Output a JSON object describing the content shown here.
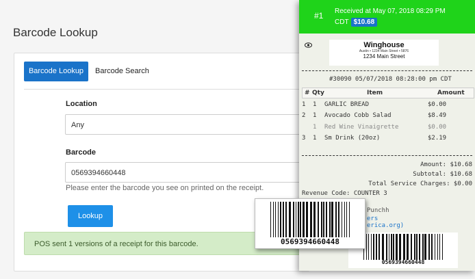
{
  "page": {
    "title": "Barcode Lookup"
  },
  "tabs": {
    "lookup": "Barcode Lookup",
    "search": "Barcode Search"
  },
  "form": {
    "location_label": "Location",
    "location_value": "Any",
    "barcode_label": "Barcode",
    "barcode_value": "0569394660448",
    "help": "Please enter the barcode you see on printed on the receipt.",
    "button": "Lookup",
    "alert": "POS sent 1 versions of a receipt for this barcode."
  },
  "receipt": {
    "number": "#1",
    "received": "Received at May 07, 2018 08:29 PM",
    "timezone": "CDT",
    "amount_badge": "$10.68",
    "store_name": "Winghouse",
    "store_sub": "Austin • 1234 Main Street • 5876",
    "store_addr": "1234 Main Street",
    "order_line": "#30090 05/07/2018 08:28:00 pm CDT",
    "columns": [
      "#",
      "Qty",
      "Item",
      "Amount"
    ],
    "items": [
      {
        "n": "1",
        "qty": "1",
        "name": "GARLIC BREAD",
        "amount": "$0.00",
        "muted": false
      },
      {
        "n": "2",
        "qty": "1",
        "name": "Avocado Cobb Salad",
        "amount": "$8.49",
        "muted": false
      },
      {
        "n": "",
        "qty": "1",
        "name": "Red Wine Vinaigrette",
        "amount": "$0.00",
        "muted": true
      },
      {
        "n": "3",
        "qty": "1",
        "name": "Sm Drink (20oz)",
        "amount": "$2.19",
        "muted": false
      }
    ],
    "amount_line": "Amount: $10.68",
    "subtotal_line": "Subtotal: $10.68",
    "service_line": "Total Service Charges: $0.00",
    "revenue_line": "Revenue Code: COUNTER 3",
    "footer_a": "Punchh",
    "footer_b": "ers",
    "footer_c": "erica.org)",
    "barcode_number": "0569394660448"
  },
  "colors": {
    "accent": "#1a73c9",
    "header_green": "#1fd31a",
    "alert_bg": "#d4ecc8"
  },
  "icons": {
    "view": "eye-icon"
  }
}
